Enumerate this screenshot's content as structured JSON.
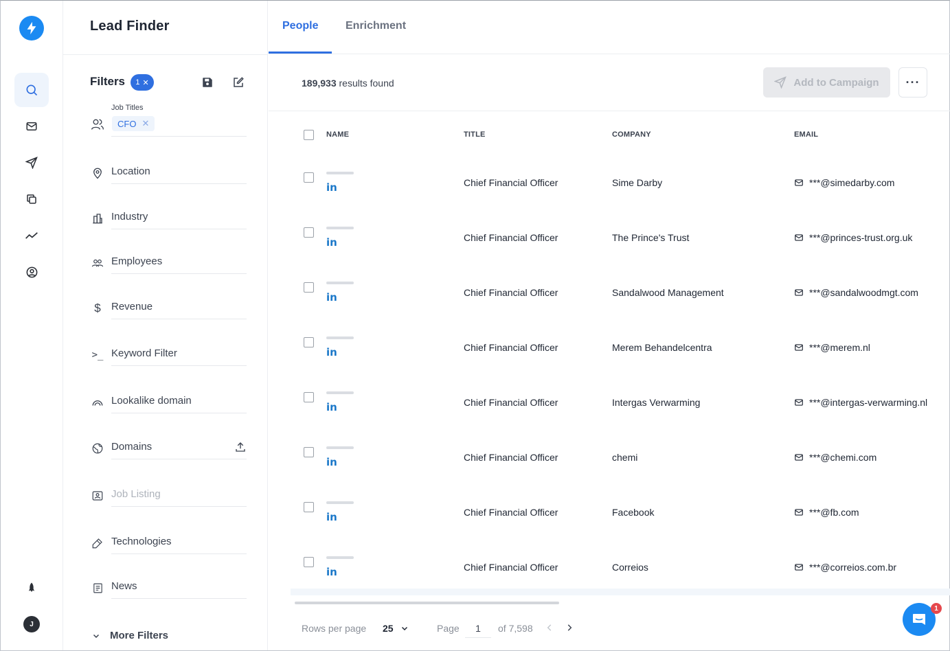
{
  "app": {
    "title": "Lead Finder",
    "user_initial": "J"
  },
  "tabs": [
    {
      "label": "People"
    },
    {
      "label": "Enrichment"
    }
  ],
  "filters": {
    "label": "Filters",
    "count": "1",
    "job_titles": {
      "caption": "Job Titles",
      "chips": [
        "CFO"
      ]
    },
    "items": [
      {
        "label": "Location"
      },
      {
        "label": "Industry"
      },
      {
        "label": "Employees"
      },
      {
        "label": "Revenue"
      },
      {
        "label": "Keyword Filter"
      },
      {
        "label": "Lookalike domain"
      },
      {
        "label": "Domains"
      },
      {
        "label": "Job Listing"
      },
      {
        "label": "Technologies"
      },
      {
        "label": "News"
      }
    ],
    "more_label": "More Filters"
  },
  "results": {
    "count": "189,933",
    "suffix": "results found"
  },
  "toolbar": {
    "add_to_campaign": "Add to Campaign",
    "more": "···"
  },
  "table": {
    "headers": [
      "NAME",
      "TITLE",
      "COMPANY",
      "EMAIL"
    ],
    "linkedin_label": "in",
    "rows": [
      {
        "title": "Chief Financial Officer",
        "company": "Sime Darby",
        "email": "***@simedarby.com"
      },
      {
        "title": "Chief Financial Officer",
        "company": "The Prince's Trust",
        "email": "***@princes-trust.org.uk"
      },
      {
        "title": "Chief Financial Officer",
        "company": "Sandalwood Management",
        "email": "***@sandalwoodmgt.com"
      },
      {
        "title": "Chief Financial Officer",
        "company": "Merem Behandelcentra",
        "email": "***@merem.nl"
      },
      {
        "title": "Chief Financial Officer",
        "company": "Intergas Verwarming",
        "email": "***@intergas-verwarming.nl"
      },
      {
        "title": "Chief Financial Officer",
        "company": "chemi",
        "email": "***@chemi.com"
      },
      {
        "title": "Chief Financial Officer",
        "company": "Facebook",
        "email": "***@fb.com"
      },
      {
        "title": "Chief Financial Officer",
        "company": "Correios",
        "email": "***@correios.com.br"
      }
    ]
  },
  "pagination": {
    "rows_per_page_label": "Rows per page",
    "rows_per_page": "25",
    "page_label": "Page",
    "page": "1",
    "of_pages": "of 7,598"
  },
  "chat": {
    "badge": "1"
  },
  "colors": {
    "accent": "#2f6fe0",
    "brand": "#1b8af2",
    "linkedin": "#1b78c9"
  }
}
